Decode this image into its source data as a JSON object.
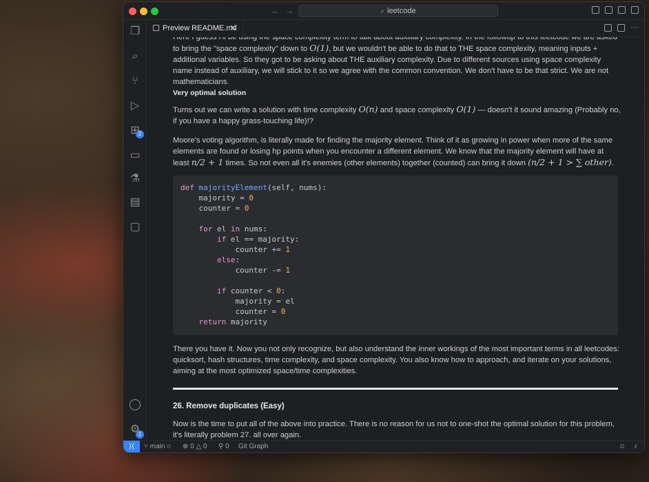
{
  "window": {
    "search_label": "leetcode",
    "tab_title": "Preview README.md",
    "tab_close": "✕"
  },
  "activity": {
    "extensions_badge": "2",
    "settings_badge": "1"
  },
  "doc": {
    "p_top_a": "Here I guess I'll be using the space complexity term to talk about auxiliary complexity. In the followup to this leetcode we are asked to bring the \"space complexity\" down to ",
    "p_top_math": "O(1)",
    "p_top_b": ", but we wouldn't be able to do that to THE space complexity, meaning inputs + additional variables. So they got to be asking about THE auxiliary complexity. Due to different sources using space complexity name instead of auxiliary, we will stick to it so we agree with the common convention. We don't have to be that strict. We are not mathematicians.",
    "heading_small": "Very optimal solution",
    "p2_a": "Turns out we can write a solution with time complexity ",
    "p2_math1": "O(n)",
    "p2_b": " and space complexity ",
    "p2_math2": "O(1)",
    "p2_c": " — doesn't it sound amazing (Probably no, if you have a happy grass-touching life)!?",
    "p3_a": "Moore's voting algorithm, is literally made for finding the majority element. Think of it as growing in power when more of the same elements are found or losing hp points when you encounter a different element. We know that the majority element will have at least ",
    "p3_math1": "n/2 + 1",
    "p3_b": " times. So not even all it's enemies (other elements) together (counted) can bring it down ",
    "p3_math2": "(n/2 + 1 > ∑ other)",
    "p3_c": ".",
    "code": {
      "l1_def": "def",
      "l1_fn": "majorityElement",
      "l1_rest": "(self, nums):",
      "l2": "majority = ",
      "l2_num": "0",
      "l3": "counter = ",
      "l3_num": "0",
      "l5_for": "for",
      "l5_mid": " el ",
      "l5_in": "in",
      "l5_rest": " nums:",
      "l6_if": "if",
      "l6_rest": " el == majority:",
      "l7": "counter += ",
      "l7_num": "1",
      "l8_else": "else",
      "l8_rest": ":",
      "l9": "counter -= ",
      "l9_num": "1",
      "l11_if": "if",
      "l11_rest": " counter < ",
      "l11_num": "0",
      "l11_colon": ":",
      "l12": "majority = el",
      "l13": "counter = ",
      "l13_num": "0",
      "l14_return": "return",
      "l14_rest": " majority"
    },
    "p4": "There you have it. Now you not only recognize, but also understand the inner workings of the most important terms in all leetcodes: quicksort, hash structures, time complexity, and space complexity. You also know how to approach, and iterate on your solutions, aiming at the most optimized space/time complexities.",
    "heading_26": "26. Remove duplicates (Easy)",
    "p5": "Now is the time to put all of the above into practice. There is no reason for us not to one-shot the optimal solution for this problem, it's literally problem 27. all over again."
  },
  "status": {
    "branch": "main",
    "errors": "0",
    "warnings": "0",
    "ports": "0",
    "git_graph": "Git Graph"
  },
  "icons": {
    "search": "search-icon",
    "explorer": "files-icon",
    "scm": "source-control-icon",
    "debug": "run-debug-icon",
    "extensions": "extensions-icon",
    "remote": "remote-explorer-icon",
    "testing": "flask-icon",
    "terminal": "terminal-icon",
    "chat": "chat-icon",
    "account": "account-icon",
    "settings": "gear-icon"
  },
  "colors": {
    "accent": "#3b82f6",
    "keyword": "#e59ad1",
    "function": "#6fa8ff",
    "number": "#f3b35a"
  }
}
